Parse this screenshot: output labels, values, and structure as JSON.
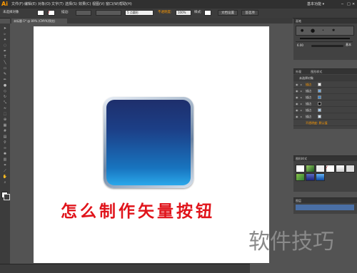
{
  "app": {
    "logo": "Ai",
    "workspace": "基本功能 ▾"
  },
  "menu": [
    "文件(F)",
    "编辑(E)",
    "对象(O)",
    "文字(T)",
    "选择(S)",
    "效果(C)",
    "视图(V)",
    "窗口(W)",
    "帮助(H)"
  ],
  "control_bar": {
    "selection": "未选择对象",
    "stroke_label": "描边:",
    "basic_label": "5 点圆形",
    "opacity_label": "不透明度:",
    "opacity_value": "100%",
    "style_label": "样式:",
    "doc_setup": "文档设置",
    "prefs": "首选项"
  },
  "document_tab": "未标题-1* @ 89% (CMYK/预览)",
  "brush_panel": {
    "title": "画笔",
    "stroke_value": "6.00",
    "basic_label": "基本"
  },
  "layers_panel": {
    "tabs": [
      "外观",
      "图形样式"
    ],
    "no_selection": "未选择对象",
    "rows": [
      {
        "name": "描边",
        "accent": true
      },
      {
        "name": "描边",
        "accent": false
      },
      {
        "name": "描边",
        "accent": false
      },
      {
        "name": "描边",
        "accent": false
      },
      {
        "name": "描边",
        "accent": false
      },
      {
        "name": "描边",
        "accent": false
      }
    ],
    "opacity_row": "不透明度:  默认值"
  },
  "graphic_styles": {
    "title": "图形样式"
  },
  "bottom_panel": {
    "title": "图层"
  },
  "artwork": {
    "title": "怎么制作矢量按钮"
  },
  "watermark": "软件技巧",
  "colors": {
    "title_red": "#e0141b",
    "button_top": "#1e2f6c",
    "button_bottom": "#2aa8ea"
  }
}
